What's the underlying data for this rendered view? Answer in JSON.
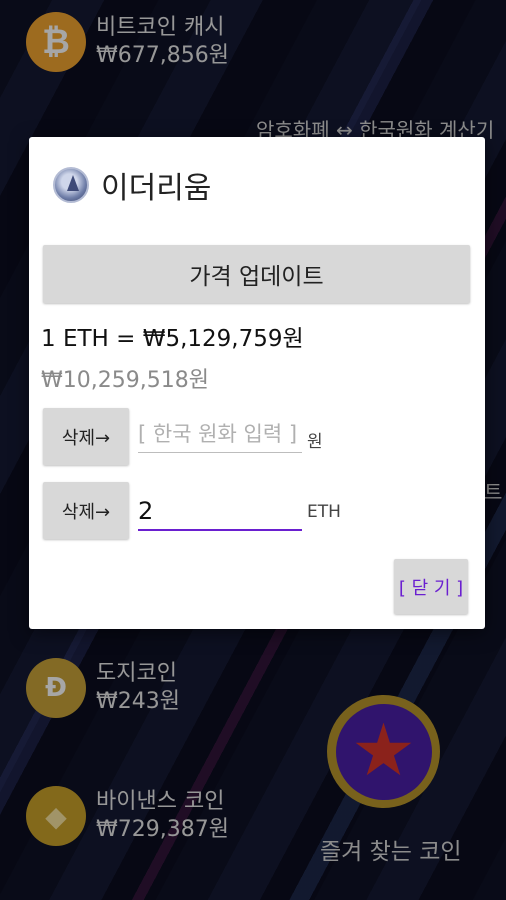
{
  "background": {
    "coins": [
      {
        "name": "비트코인 캐시",
        "price": "₩677,856원",
        "icon": "bitcoin-cash-icon"
      },
      {
        "name": "도지코인",
        "price": "₩243원",
        "icon": "dogecoin-icon"
      },
      {
        "name": "바이낸스 코인",
        "price": "₩729,387원",
        "icon": "binance-coin-icon"
      }
    ],
    "calculator_link": "암호화폐 ↔ 한국원화 계산기",
    "favorites_label": "즐겨 찾는 코인",
    "right_edge_glyph": "트"
  },
  "dialog": {
    "title": "이더리움",
    "icon": "ethereum-icon",
    "update_button": "가격 업데이트",
    "rate": "1 ETH = ₩5,129,759원",
    "total": "₩10,259,518원",
    "rows": [
      {
        "delete_label": "삭제→",
        "placeholder": "[ 한국 원화 입력 ]",
        "value": "",
        "unit": "원"
      },
      {
        "delete_label": "삭제→",
        "placeholder": "",
        "value": "2",
        "unit": "ETH"
      }
    ],
    "close_button": "[ 닫 기 ]"
  },
  "colors": {
    "accent": "#6a1fd0",
    "button_bg": "#d8d8d8",
    "favorite_ring": "#b8962b",
    "favorite_fill": "#4a1fa8",
    "favorite_star": "#d6352a"
  }
}
